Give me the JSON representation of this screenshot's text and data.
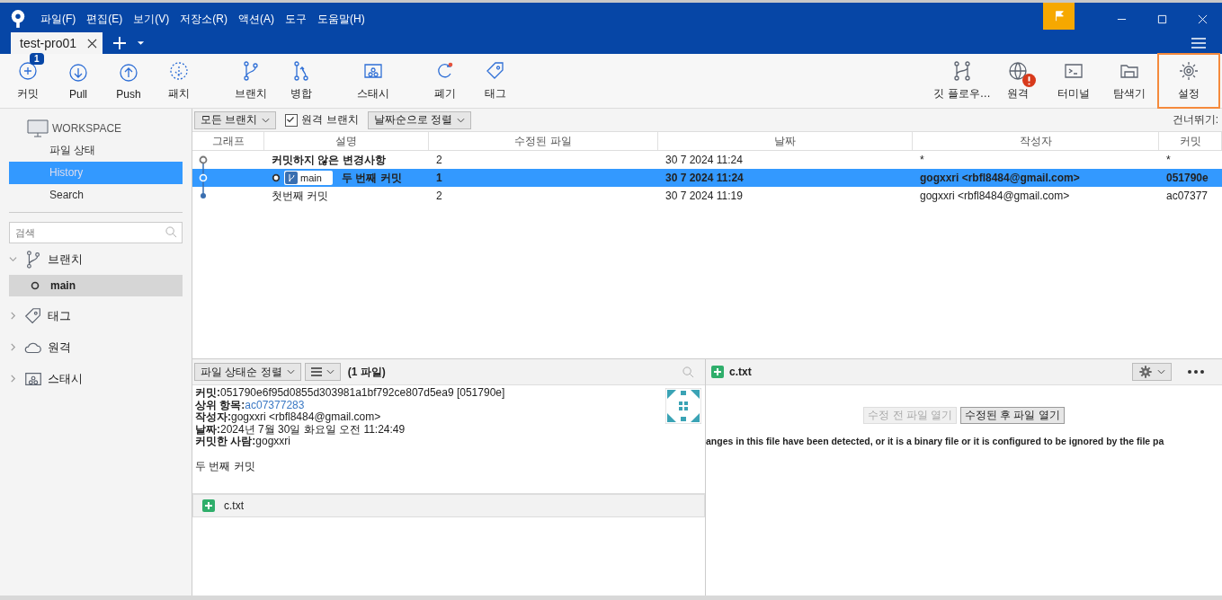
{
  "window": {
    "menu": [
      "파일(F)",
      "편집(E)",
      "보기(V)",
      "저장소(R)",
      "액션(A)",
      "도구",
      "도움말(H)"
    ]
  },
  "tabs": [
    {
      "label": "test-pro01",
      "selected": true
    }
  ],
  "toolbar": {
    "left": [
      {
        "label": "커밋",
        "badge": "1"
      },
      {
        "label": "Pull"
      },
      {
        "label": "Push"
      },
      {
        "label": "패치"
      },
      {
        "label": "브랜치"
      },
      {
        "label": "병합"
      },
      {
        "label": "스태시"
      },
      {
        "label": "폐기"
      },
      {
        "label": "태그"
      }
    ],
    "right": [
      {
        "label": "깃 플로우…",
        "alert": false,
        "highlighted": false
      },
      {
        "label": "원격",
        "alert": true,
        "highlighted": false
      },
      {
        "label": "터미널",
        "alert": false,
        "highlighted": false
      },
      {
        "label": "탐색기",
        "alert": false,
        "highlighted": false
      },
      {
        "label": "설정",
        "alert": false,
        "highlighted": true
      }
    ]
  },
  "sidebar": {
    "workspace": {
      "title": "WORKSPACE",
      "items": [
        {
          "label": "파일 상태",
          "selected": false
        },
        {
          "label": "History",
          "selected": true
        },
        {
          "label": "Search",
          "selected": false
        }
      ]
    },
    "search": {
      "placeholder": "검색"
    },
    "groups": [
      {
        "label": "브랜치",
        "expanded": true,
        "children": [
          {
            "label": "main",
            "selected": true
          }
        ]
      },
      {
        "label": "태그",
        "expanded": false
      },
      {
        "label": "원격",
        "expanded": false
      },
      {
        "label": "스태시",
        "expanded": false
      }
    ]
  },
  "filters": {
    "branches": "모든 브랜치",
    "remote_branches": {
      "label": "원격 브랜치",
      "checked": true
    },
    "sort": "날짜순으로 정렬",
    "jump": "건너뛰기:"
  },
  "commits": {
    "columns": [
      "그래프",
      "설명",
      "수정된 파일",
      "날짜",
      "작성자",
      "커밋"
    ],
    "rows": [
      {
        "kind": "uncommitted",
        "description": "커밋하지 않은 변경사항",
        "files": "2",
        "date": "30 7 2024 11:24",
        "author": "*",
        "commit": "*",
        "selected": false
      },
      {
        "kind": "commit",
        "branch": "main",
        "description": "두 번째 커밋",
        "files": "1",
        "date": "30 7 2024 11:24",
        "author": "gogxxri <rbfl8484@gmail.com>",
        "commit": "051790e",
        "selected": true
      },
      {
        "kind": "commit",
        "description": "첫번째 커밋",
        "files": "2",
        "date": "30 7 2024 11:19",
        "author": "gogxxri <rbfl8484@gmail.com>",
        "commit": "ac07377",
        "selected": false
      }
    ]
  },
  "details": {
    "sort": "파일 상태순 정렬",
    "count": "(1 파일)",
    "fields": [
      {
        "label": "커밋:",
        "value": "051790e6f95d0855d303981a1bf792ce807d5ea9 [051790e]",
        "kind": "text"
      },
      {
        "label": "상위 항목:",
        "value": "ac07377283",
        "kind": "link"
      },
      {
        "label": "작성자:",
        "value": "gogxxri <rbfl8484@gmail.com>",
        "kind": "text"
      },
      {
        "label": "날짜:",
        "value": "2024년 7월 30일 화요일 오전 11:24:49",
        "kind": "text"
      },
      {
        "label": "커밋한 사람:",
        "value": "gogxxri",
        "kind": "text"
      }
    ],
    "message": "두 번째 커밋",
    "files": [
      {
        "name": "c.txt",
        "kind": "added"
      }
    ]
  },
  "diff": {
    "file": {
      "name": "c.txt",
      "kind": "added"
    },
    "buttons": [
      {
        "label": "수정 전 파일 열기",
        "disabled": true
      },
      {
        "label": "수정된 후 파일 열기",
        "disabled": false
      }
    ],
    "notice": "anges in this file have been detected, or it is a binary file or it is configured to be ignored by the file pa"
  }
}
